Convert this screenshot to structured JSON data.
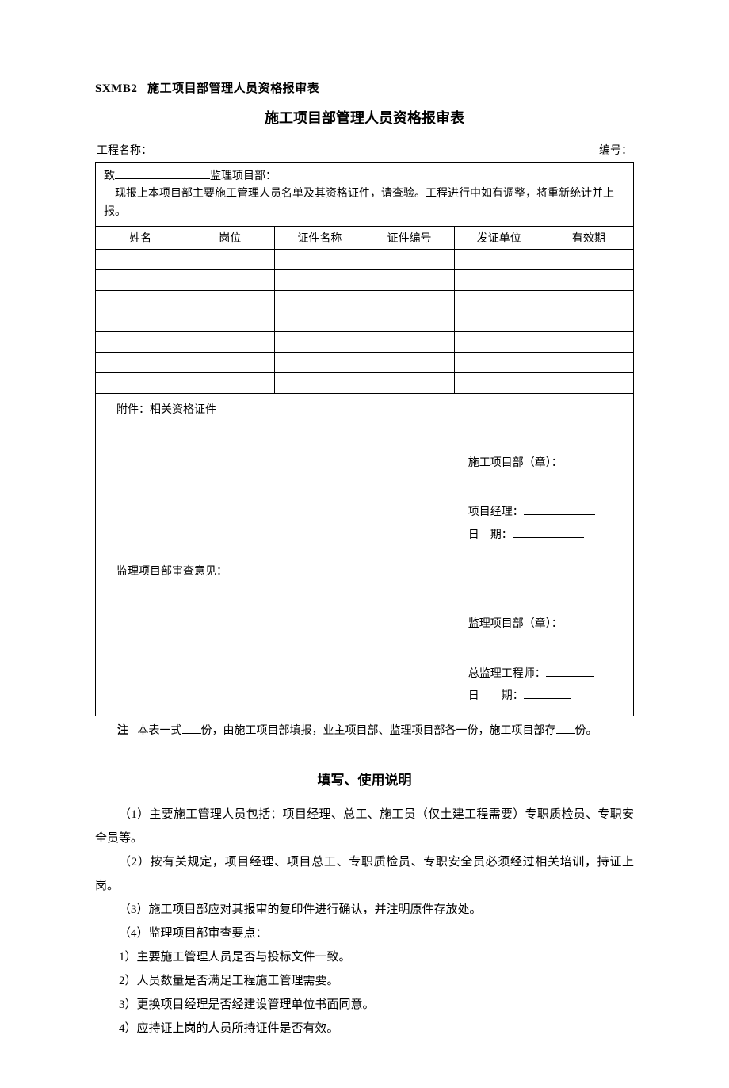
{
  "form_code_id": "SXMB2",
  "form_code_name": "施工项目部管理人员资格报审表",
  "title": "施工项目部管理人员资格报审表",
  "header": {
    "project_label": "工程名称：",
    "number_label": "编号："
  },
  "intro": {
    "to_prefix": "致",
    "to_suffix": "监理项目部：",
    "statement": "现报上本项目部主要施工管理人员名单及其资格证件，请查验。工程进行中如有调整，将重新统计并上报。"
  },
  "columns": [
    "姓名",
    "岗位",
    "证件名称",
    "证件编号",
    "发证单位",
    "有效期"
  ],
  "attachment_label": "附件：相关资格证件",
  "sig_construction": {
    "dept": "施工项目部（章）：",
    "manager": "项目经理：",
    "date_label": "日",
    "date_label2": "期："
  },
  "supervision_opinion_label": "监理项目部审查意见：",
  "sig_supervision": {
    "dept": "监理项目部（章）：",
    "engineer": "总监理工程师：",
    "date_label": "日",
    "date_label2": "期："
  },
  "note": {
    "label": "注",
    "text_before": "本表一式",
    "text_mid": "份，由施工项目部填报，业主项目部、监理项目部各一份，施工项目部存",
    "text_after": "份。"
  },
  "instructions_title": "填写、使用说明",
  "instructions": [
    "（1）主要施工管理人员包括：项目经理、总工、施工员（仅土建工程需要）专职质检员、专职安全员等。",
    "（2）按有关规定，项目经理、项目总工、专职质检员、专职安全员必须经过相关培训，持证上岗。",
    "（3）施工项目部应对其报审的复印件进行确认，并注明原件存放处。",
    "（4）监理项目部审查要点：",
    "1）主要施工管理人员是否与投标文件一致。",
    "2）人员数量是否满足工程施工管理需要。",
    "3）更换项目经理是否经建设管理单位书面同意。",
    "4）应持证上岗的人员所持证件是否有效。"
  ]
}
